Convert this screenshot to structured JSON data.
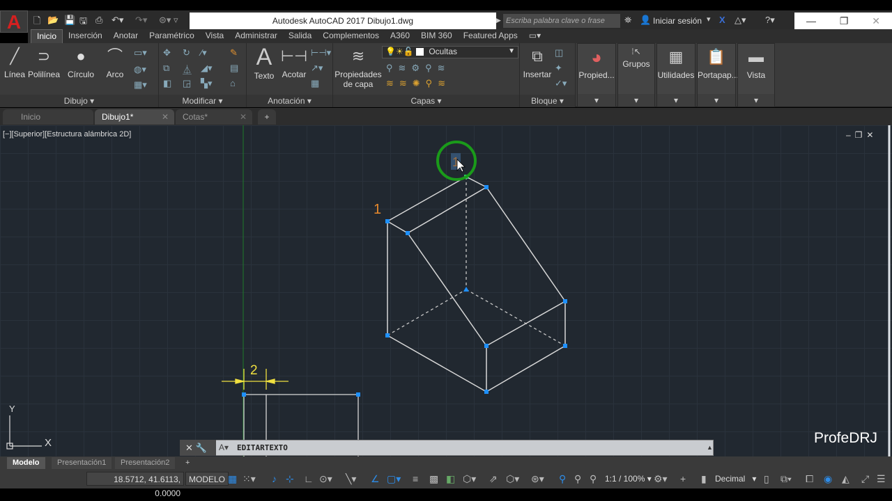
{
  "title": "Autodesk AutoCAD 2017    Dibujo1.dwg",
  "app_logo": "A",
  "search_placeholder": "Escriba palabra clave o frase",
  "signin": "Iniciar sesión",
  "ribbon_tabs": [
    "Inicio",
    "Inserción",
    "Anotar",
    "Paramétrico",
    "Vista",
    "Administrar",
    "Salida",
    "Complementos",
    "A360",
    "BIM 360",
    "Featured Apps"
  ],
  "panels": {
    "dibujo": "Dibujo",
    "modificar": "Modificar",
    "anotacion": "Anotación",
    "capas": "Capas",
    "bloque": "Bloque"
  },
  "tools": {
    "linea": "Línea",
    "polilinea": "Polilínea",
    "circulo": "Círculo",
    "arco": "Arco",
    "texto": "Texto",
    "acotar": "Acotar",
    "propcapa1": "Propiedades",
    "propcapa2": "de capa",
    "insertar": "Insertar",
    "propied": "Propied...",
    "grupos": "Grupos",
    "utilidades": "Utilidades",
    "portapap": "Portapap...",
    "vista": "Vista"
  },
  "layer_select": "Ocultas",
  "doc_tabs": [
    {
      "label": "Inicio"
    },
    {
      "label": "Dibujo1*"
    },
    {
      "label": "Cotas*"
    }
  ],
  "viewport_label": "[−][Superior][Estructura alámbrica 2D]",
  "drawing": {
    "label_1": "1",
    "edit_text": "1",
    "dim_2": "2",
    "axis_x": "X",
    "axis_y": "Y"
  },
  "command": "EDITARTEXTO",
  "layout_tabs": [
    "Modelo",
    "Presentación1",
    "Presentación2"
  ],
  "status": {
    "coords": "18.5712, 41.6113, 0.0000",
    "space": "MODELO",
    "scale": "1:1 / 100%",
    "units": "Decimal"
  },
  "watermark": "ProfeDRJ",
  "colors": {
    "canvas": "#212830",
    "grip": "#1e90ff",
    "accent_orange": "#e8892c",
    "dim_yellow": "#f0e040",
    "snap_green": "#1a9a1a"
  }
}
